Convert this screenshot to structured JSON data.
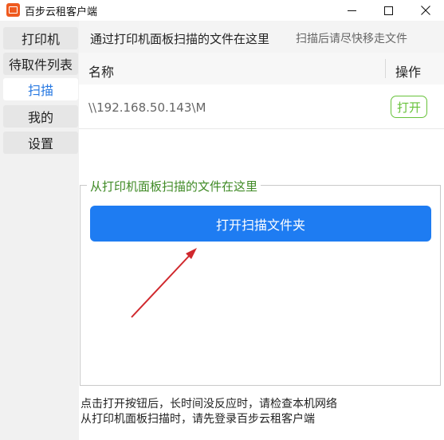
{
  "window": {
    "title": "百步云租客户端"
  },
  "sidebar": {
    "items": [
      {
        "label": "打印机"
      },
      {
        "label": "待取件列表"
      },
      {
        "label": "扫描"
      },
      {
        "label": "我的"
      },
      {
        "label": "设置"
      }
    ],
    "active_index": 2
  },
  "main": {
    "hint_main": "通过打印机面板扫描的文件在这里",
    "hint_sub": "扫描后请尽快移走文件",
    "table": {
      "columns": [
        "名称",
        "操作"
      ],
      "rows": [
        {
          "path": "\\\\192.168.50.143\\M",
          "action": "打开"
        }
      ]
    },
    "group_title": "从打印机面板扫描的文件在这里",
    "open_folder_button": "打开扫描文件夹",
    "notes": [
      "点击打开按钮后，长时间没反应时，请检查本机网络",
      "从打印机面板扫描时，请先登录百步云租客户端"
    ]
  },
  "colors": {
    "accent": "#1e7cf2",
    "active_nav": "#2a7ae2",
    "open_button": "#67c23a",
    "group_title": "#3f8a25",
    "annotation_arrow": "#d0282d"
  },
  "icons": {
    "app": "app-logo-icon",
    "minimize": "minimize-icon",
    "maximize": "maximize-icon",
    "close": "close-icon"
  }
}
